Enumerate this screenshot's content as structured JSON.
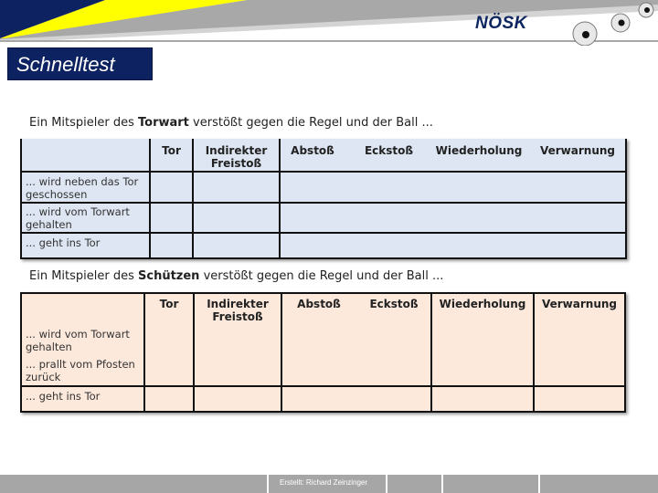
{
  "header": {
    "brand": "NÖSK",
    "title": "Schnelltest",
    "colors": {
      "navy": "#0d2260",
      "yellow": "#ffff00",
      "gray": "#a8a8a8"
    }
  },
  "table1": {
    "caption_pre": "Ein Mitspieler des ",
    "caption_bold": "Torwart",
    "caption_post": " verstößt gegen die Regel und der Ball ...",
    "bg": "#dde6f2",
    "columns": [
      "",
      "Tor",
      "Indirekter Freistoß",
      "Abstoß",
      "Eckstoß",
      "Wiederholung",
      "Verwarnung"
    ],
    "rows": [
      "... wird neben das Tor geschossen",
      "... wird vom Torwart gehalten",
      "... geht ins Tor"
    ]
  },
  "table2": {
    "caption_pre": "Ein Mitspieler des ",
    "caption_bold": "Schützen",
    "caption_post": " verstößt gegen die Regel und der Ball ...",
    "bg": "#fde9dc",
    "columns": [
      "",
      "Tor",
      "Indirekter Freistoß",
      "Abstoß",
      "Eckstoß",
      "Wiederholung",
      "Verwarnung"
    ],
    "rows": [
      "... wird vom Torwart gehalten",
      "... prallt vom Pfosten zurück",
      "... geht ins Tor"
    ]
  },
  "footer": {
    "credit": "Erstellt: Richard Zeinzinger"
  }
}
